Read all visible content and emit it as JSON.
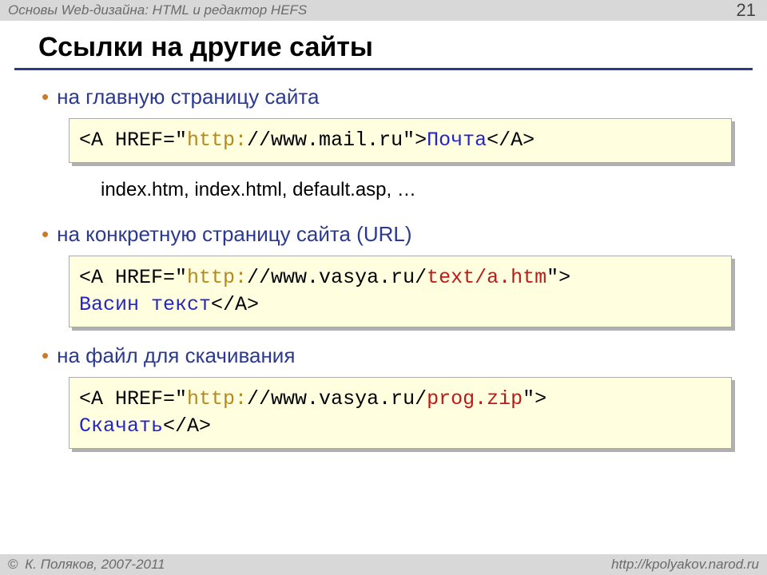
{
  "header": {
    "course_title": "Основы Web-дизайна: HTML и редактор HEFS",
    "page_number": "21"
  },
  "slide": {
    "title": "Ссылки на другие сайты"
  },
  "bullets": {
    "b1": "на главную страницу сайта",
    "b2": "на конкретную страницу сайта (URL)",
    "b3": "на файл для скачивания"
  },
  "code1": {
    "p1": "<A HREF=\"",
    "p2": "http:",
    "p3": "//www.mail.ru\">",
    "p4": "Почта",
    "p5": "</A>"
  },
  "index_line": "index.htm, index.html, default.asp, …",
  "code2": {
    "p1": "<A HREF=\"",
    "p2": "http:",
    "p3": "//www.vasya.ru/",
    "p4": "text/a.htm",
    "p5": "\">",
    "p6": "Васин текст",
    "p7": "</A>"
  },
  "code3": {
    "p1": "<A HREF=\"",
    "p2": "http:",
    "p3": "//www.vasya.ru/",
    "p4": "prog.zip",
    "p5": "\">",
    "p6": "Скачать",
    "p7": "</A>"
  },
  "footer": {
    "copyright": "К. Поляков, 2007-2011",
    "url": "http://kpolyakov.narod.ru"
  }
}
